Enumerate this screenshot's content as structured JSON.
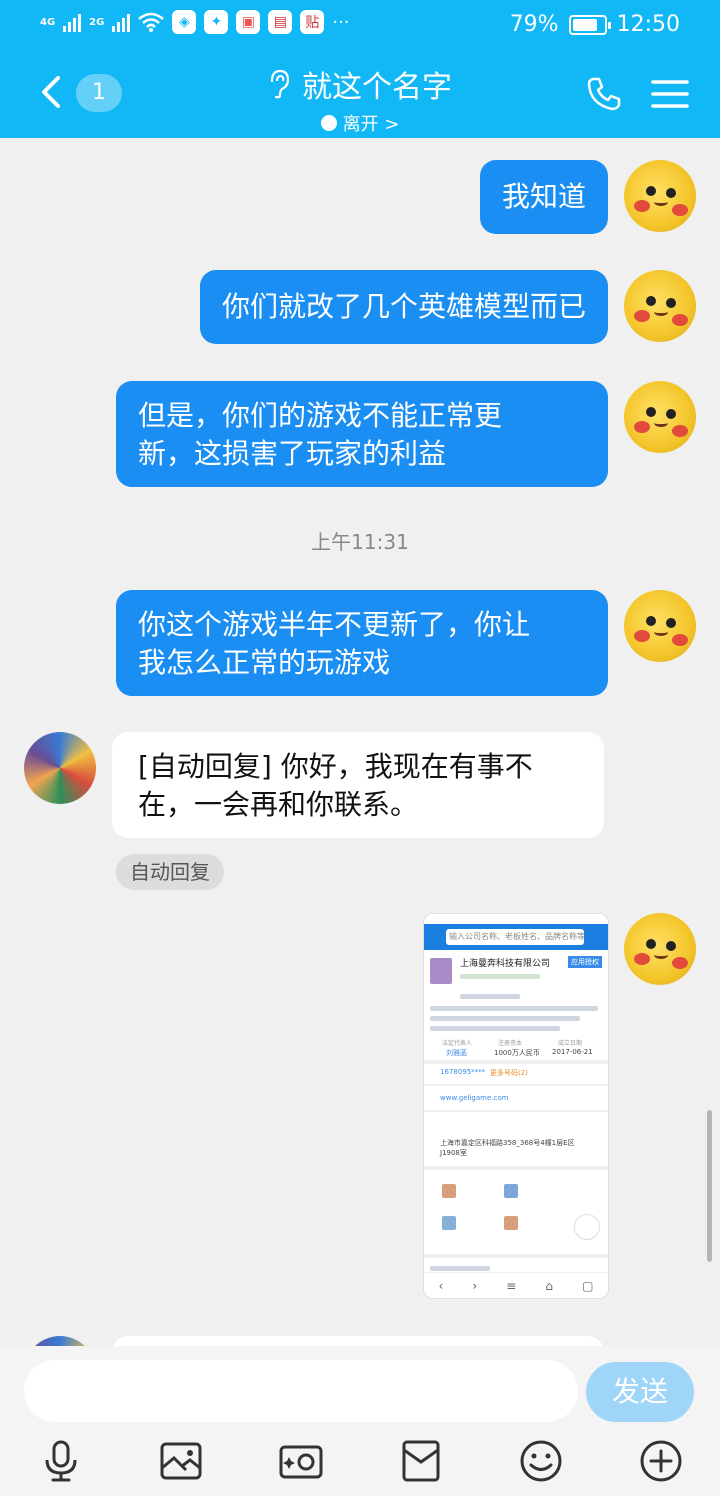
{
  "status": {
    "sig1": "4G",
    "sig2": "2G",
    "battery_pct": "79%",
    "battery_level": 0.79,
    "time": "12:50"
  },
  "header": {
    "unread_count": "1",
    "title": "就这个名字",
    "presence": "离开 >"
  },
  "messages": [
    {
      "side": "right",
      "text": "我知道"
    },
    {
      "side": "right",
      "text": "你们就改了几个英雄模型而已"
    },
    {
      "side": "right",
      "lines": [
        "但是，你们的游戏不能正常更",
        "新，这损害了玩家的利益"
      ]
    },
    {
      "type": "time",
      "text": "上午11:31"
    },
    {
      "side": "right",
      "lines": [
        "你这个游戏半年不更新了，你让",
        "我怎么正常的玩游戏"
      ]
    },
    {
      "side": "left",
      "lines": [
        "[自动回复] 你好，我现在有事不",
        "在，一会再和你联系。"
      ],
      "tag": "自动回复"
    },
    {
      "side": "right",
      "type": "image",
      "image_text": {
        "search_placeholder": "输入公司名称、老板姓名、品牌名称等",
        "company": "上海曼奔科技有限公司",
        "button": "应用授权",
        "phone": "1678095****",
        "phone_more": "更多号码(2)",
        "website": "www.geligame.com",
        "address": "上海市嘉定区科福路358_368号4幢1层E区J1908室",
        "rep_label": "法定代表人",
        "rep": "刘雅菡",
        "capital_label": "注册资本",
        "capital": "1000万人民币",
        "date_label": "成立日期",
        "date": "2017-06-21"
      }
    }
  ],
  "composer": {
    "send_label": "发送"
  },
  "toolbar": [
    "mic-icon",
    "image-icon",
    "camera-icon",
    "red-packet-icon",
    "emoji-icon",
    "plus-icon"
  ]
}
